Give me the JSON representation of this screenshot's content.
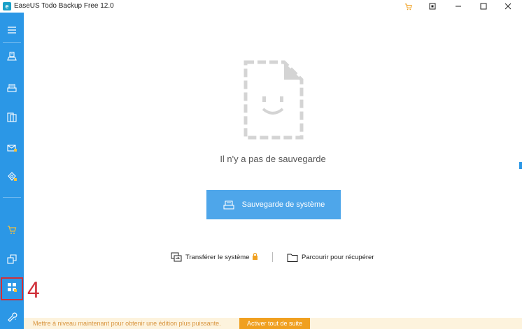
{
  "window": {
    "title": "EaseUS Todo Backup Free 12.0",
    "app_icon_glyph": "e",
    "controls": [
      "cart-icon",
      "restore-icon",
      "minimize-icon",
      "maximize-icon",
      "close-icon"
    ]
  },
  "sidebar": {
    "items": [
      {
        "name": "menu",
        "icon": "hamburger-icon"
      },
      {
        "name": "disk-backup",
        "icon": "disk-backup-icon"
      },
      {
        "name": "system-backup",
        "icon": "system-backup-icon"
      },
      {
        "name": "file-backup",
        "icon": "file-backup-icon"
      },
      {
        "name": "mail-backup",
        "icon": "mail-backup-icon"
      },
      {
        "name": "smart-backup",
        "icon": "smart-backup-icon"
      },
      {
        "name": "store",
        "icon": "cart-icon"
      },
      {
        "name": "clone",
        "icon": "clone-icon"
      },
      {
        "name": "tools",
        "icon": "tools-grid-icon"
      },
      {
        "name": "settings",
        "icon": "wrench-icon"
      }
    ]
  },
  "annotation": {
    "step_number": "4"
  },
  "main": {
    "empty_message": "Il n'y a pas de sauvegarde",
    "primary_button_label": "Sauvegarde de système",
    "links": {
      "transfer_label": "Transférer le système",
      "browse_label": "Parcourir pour récupérer"
    }
  },
  "footer": {
    "message": "Mettre à niveau maintenant pour obtenir une édition plus puissante.",
    "button_label": "Activer tout de suite"
  },
  "colors": {
    "sidebar": "#2b97e6",
    "primary_button": "#4ea6ea",
    "highlight": "#d0303a",
    "footer_bg": "#fdf3dd",
    "footer_button": "#f0a020"
  }
}
